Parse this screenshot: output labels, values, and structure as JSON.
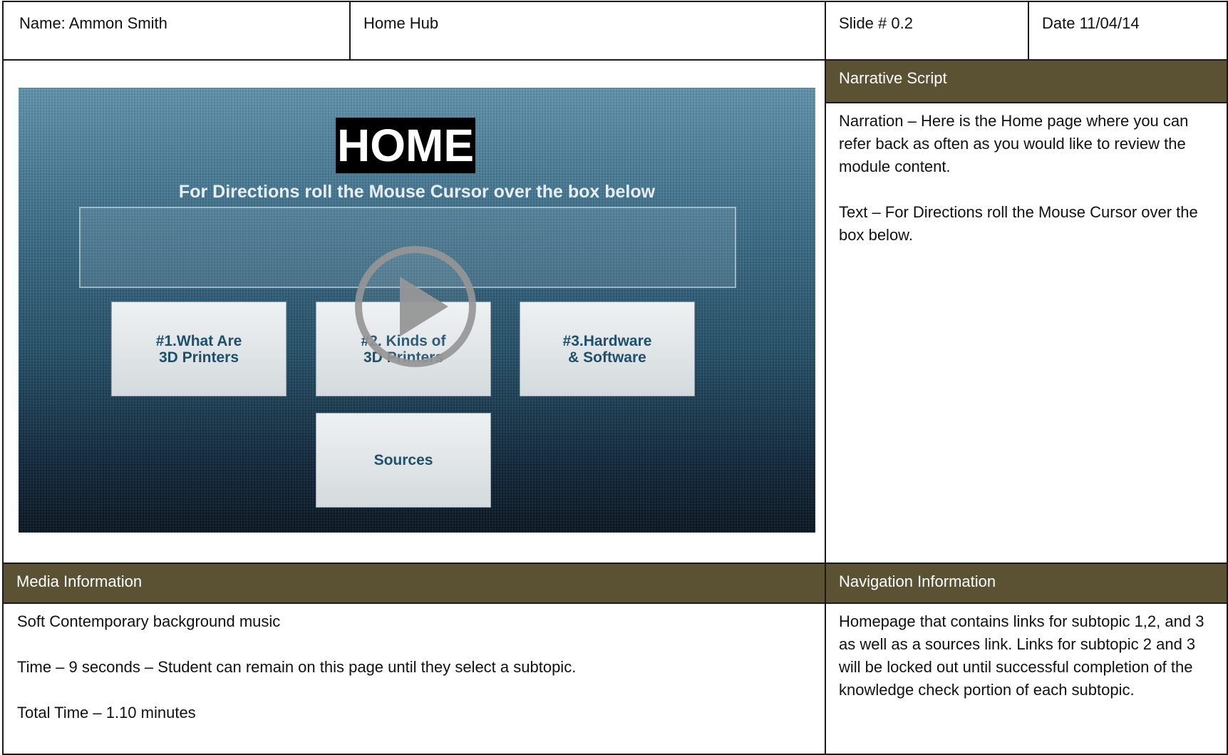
{
  "header": {
    "name": "Name: Ammon Smith",
    "title": "Home Hub",
    "slide": "Slide # 0.2",
    "date": "Date 11/04/14"
  },
  "preview": {
    "heading": "HOME",
    "directions": "For Directions roll the Mouse Cursor over the box below",
    "tiles": [
      "#1.What Are\n3D Printers",
      "#2. Kinds of\n3D Printers",
      "#3.Hardware\n& Software",
      "Sources"
    ],
    "play_icon": "play-circle-icon"
  },
  "narrative": {
    "header": "Narrative Script",
    "paragraphs": [
      "Narration – Here is the Home page where you can refer back as often as you would like to review the module content.",
      "Text – For Directions roll the Mouse Cursor over the box below."
    ]
  },
  "media": {
    "header": "Media Information",
    "paragraphs": [
      "Soft Contemporary background music",
      "Time – 9 seconds – Student can remain on this page until they select a subtopic.",
      "Total Time – 1.10 minutes"
    ]
  },
  "navigation": {
    "header": "Navigation Information",
    "paragraphs": [
      "Homepage that contains links for subtopic 1,2, and 3 as well as a sources link. Links for subtopic 2 and 3 will be locked out until successful completion of the knowledge check portion of each subtopic."
    ]
  },
  "colors": {
    "header_bar": "#5a5233",
    "tile_text": "#1e4f6b",
    "border": "#1a1a1a"
  }
}
